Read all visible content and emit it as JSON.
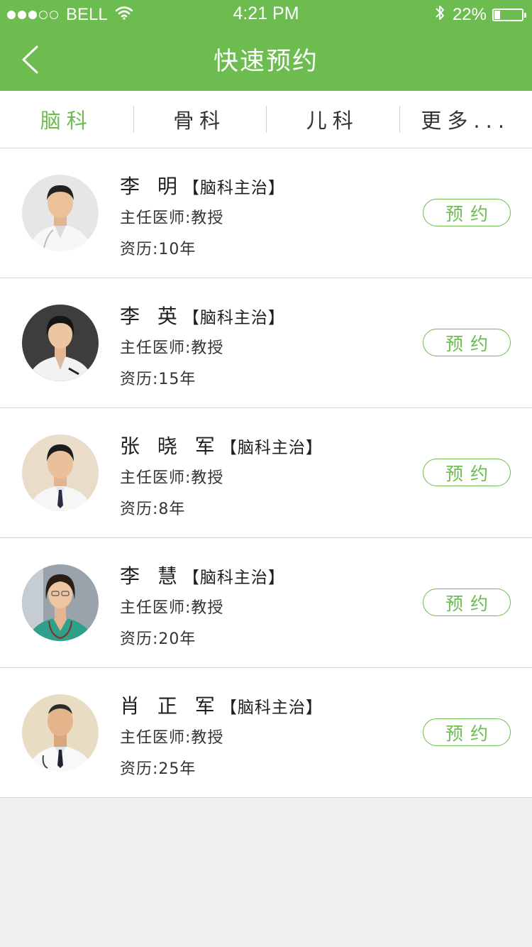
{
  "status_bar": {
    "carrier": "BELL",
    "time": "4:21 PM",
    "battery_text": "22%",
    "battery_level": 0.22,
    "signal_dots_full": 3,
    "signal_dots_total": 5
  },
  "header": {
    "title": "快速预约",
    "back_icon": "chevron-left-icon",
    "background_color": "#6cbc50"
  },
  "tabs": [
    {
      "label": "脑科",
      "active": true
    },
    {
      "label": "骨科",
      "active": false
    },
    {
      "label": "儿科",
      "active": false
    },
    {
      "label": "更多...",
      "active": false
    }
  ],
  "accent_color": "#6cbc50",
  "doctors": [
    {
      "name": "李 明",
      "dept": "【脑科主治】",
      "title": "主任医师:教授",
      "experience": "资历:10年",
      "book_label": "预约"
    },
    {
      "name": "李 英",
      "dept": "【脑科主治】",
      "title": "主任医师:教授",
      "experience": "资历:15年",
      "book_label": "预约"
    },
    {
      "name": "张 晓 军",
      "dept": "【脑科主治】",
      "title": "主任医师:教授",
      "experience": "资历:8年",
      "book_label": "预约"
    },
    {
      "name": "李 慧",
      "dept": "【脑科主治】",
      "title": "主任医师:教授",
      "experience": "资历:20年",
      "book_label": "预约"
    },
    {
      "name": "肖 正 军",
      "dept": "【脑科主治】",
      "title": "主任医师:教授",
      "experience": "资历:25年",
      "book_label": "预约"
    }
  ]
}
